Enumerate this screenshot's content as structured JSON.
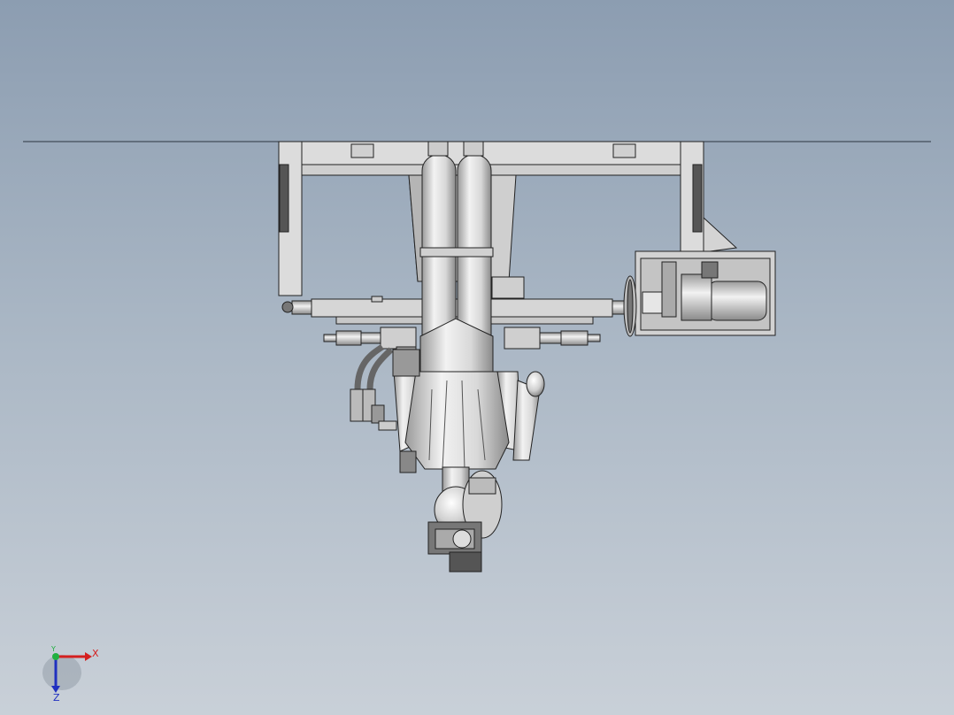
{
  "triad": {
    "x_label": "X",
    "y_label": "Y",
    "z_label": "Z",
    "x_color": "#d42020",
    "y_color": "#20b040",
    "z_color": "#2030c0"
  },
  "colors": {
    "part_fill": "#dcdcdc",
    "part_fill_dark": "#bdbdbd",
    "edge": "#222222",
    "shadow": "#5a5a5a",
    "ground_line": "#2b3540"
  }
}
